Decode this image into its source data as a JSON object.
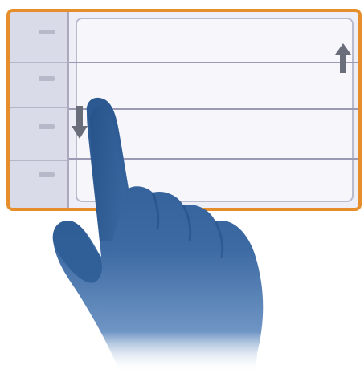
{
  "illustration": {
    "icons": {
      "scroll_up": "arrow-up-icon",
      "scroll_down": "arrow-down-icon",
      "pointer": "hand-pointer-icon"
    },
    "colors": {
      "frame_border": "#e58e2b",
      "list_background": "#edeef6",
      "gutter_background": "#d9dbe8",
      "arrow": "#6a6e7a",
      "hand": "#2e5c95"
    },
    "list": {
      "row_count": 4
    }
  }
}
